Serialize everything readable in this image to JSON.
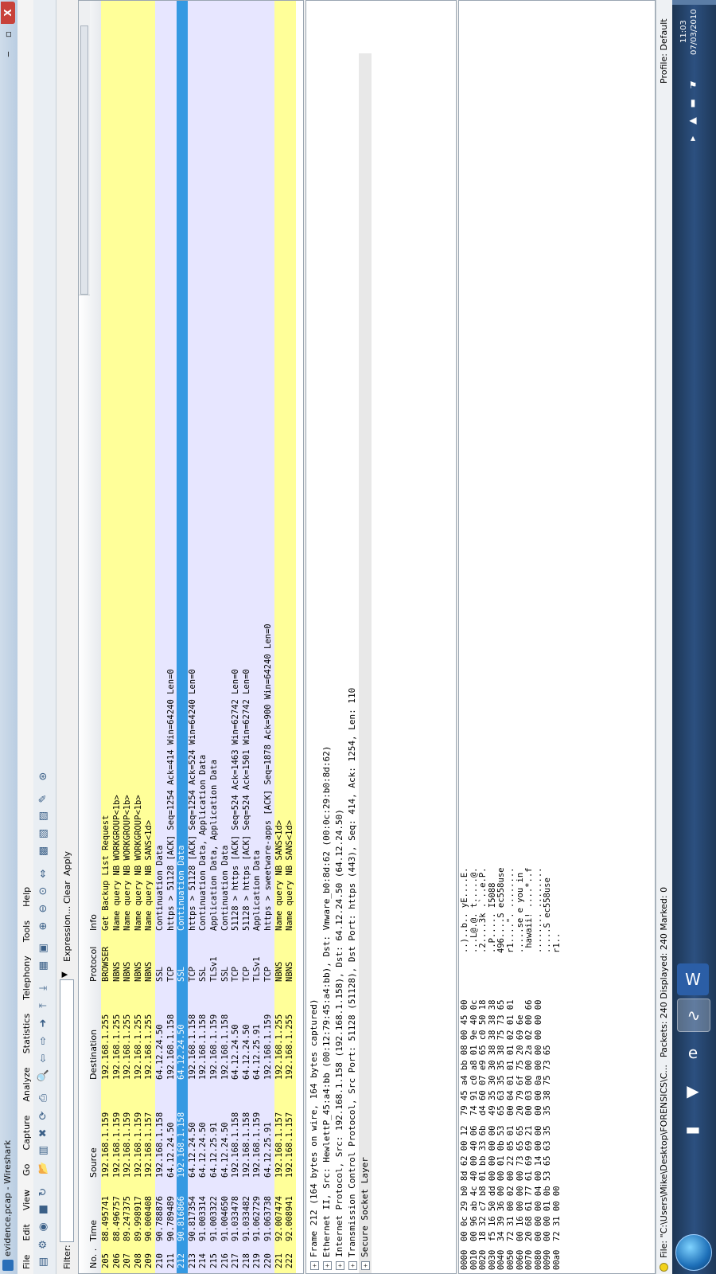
{
  "window": {
    "title": "evidence.pcap - Wireshark",
    "min": "‒",
    "max": "▫",
    "close": "X"
  },
  "menu": [
    "File",
    "Edit",
    "View",
    "Go",
    "Capture",
    "Analyze",
    "Statistics",
    "Telephony",
    "Tools",
    "Help"
  ],
  "filter": {
    "label": "Filter:",
    "value": "",
    "expression": "Expression...",
    "clear": "Clear",
    "apply": "Apply"
  },
  "columns": {
    "no": "No. .",
    "time": "Time",
    "source": "Source",
    "destination": "Destination",
    "protocol": "Protocol",
    "info": "Info"
  },
  "colors": {
    "yellow": "#ffff99",
    "lavender": "#e7e6ff",
    "selected": "#3599e2"
  },
  "packets": [
    {
      "no": "205",
      "time": "88.495741",
      "source": "192.168.1.159",
      "destination": "192.168.1.255",
      "protocol": "BROWSER",
      "info": "Get Backup List Request",
      "color": "yellow"
    },
    {
      "no": "206",
      "time": "88.496757",
      "source": "192.168.1.159",
      "destination": "192.168.1.255",
      "protocol": "NBNS",
      "info": "Name query NB WORKGROUP<1b>",
      "color": "yellow"
    },
    {
      "no": "207",
      "time": "89.247375",
      "source": "192.168.1.159",
      "destination": "192.168.1.255",
      "protocol": "NBNS",
      "info": "Name query NB WORKGROUP<1b>",
      "color": "yellow"
    },
    {
      "no": "208",
      "time": "89.998917",
      "source": "192.168.1.159",
      "destination": "192.168.1.255",
      "protocol": "NBNS",
      "info": "Name query NB WORKGROUP<1b>",
      "color": "yellow"
    },
    {
      "no": "209",
      "time": "90.000408",
      "source": "192.168.1.157",
      "destination": "192.168.1.255",
      "protocol": "NBNS",
      "info": "Name query NB SANS<1d>",
      "color": "yellow"
    },
    {
      "no": "210",
      "time": "90.788876",
      "source": "192.168.1.158",
      "destination": "64.12.24.50",
      "protocol": "SSL",
      "info": "Continuation Data",
      "color": "lavender"
    },
    {
      "no": "211",
      "time": "90.789489",
      "source": "64.12.24.50",
      "destination": "192.168.1.158",
      "protocol": "TCP",
      "info": "https > 51128 [ACK] Seq=1254 Ack=414 Win=64240 Len=0",
      "color": "lavender"
    },
    {
      "no": "212",
      "time": "90.816866",
      "source": "192.168.1.158",
      "destination": "64.12.24.50",
      "protocol": "SSL",
      "info": "Continuation Data",
      "color": "selected"
    },
    {
      "no": "213",
      "time": "90.817354",
      "source": "64.12.24.50",
      "destination": "192.168.1.158",
      "protocol": "TCP",
      "info": "https > 51128 [ACK] Seq=1254 Ack=524 Win=64240 Len=0",
      "color": "lavender"
    },
    {
      "no": "214",
      "time": "91.003314",
      "source": "64.12.24.50",
      "destination": "192.168.1.158",
      "protocol": "SSL",
      "info": "Continuation Data, Application Data",
      "color": "lavender"
    },
    {
      "no": "215",
      "time": "91.003322",
      "source": "64.12.25.91",
      "destination": "192.168.1.159",
      "protocol": "TLSv1",
      "info": "Application Data, Application Data",
      "color": "lavender"
    },
    {
      "no": "216",
      "time": "91.004650",
      "source": "64.12.24.50",
      "destination": "192.168.1.158",
      "protocol": "SSL",
      "info": "Continuation Data",
      "color": "lavender"
    },
    {
      "no": "217",
      "time": "91.033478",
      "source": "192.168.1.158",
      "destination": "64.12.24.50",
      "protocol": "TCP",
      "info": "51128 > https [ACK] Seq=524 Ack=1463 Win=62742 Len=0",
      "color": "lavender"
    },
    {
      "no": "218",
      "time": "91.033482",
      "source": "192.168.1.158",
      "destination": "64.12.24.50",
      "protocol": "TCP",
      "info": "51128 > https [ACK] Seq=524 Ack=1501 Win=62742 Len=0",
      "color": "lavender"
    },
    {
      "no": "219",
      "time": "91.062729",
      "source": "192.168.1.159",
      "destination": "64.12.25.91",
      "protocol": "TLSv1",
      "info": "Application Data",
      "color": "lavender"
    },
    {
      "no": "220",
      "time": "91.063738",
      "source": "64.12.25.91",
      "destination": "192.168.1.159",
      "protocol": "TCP",
      "info": "https > sweetware-apps [ACK] Seq=1878 Ack=900 Win=64240 Len=0",
      "color": "lavender"
    },
    {
      "no": "221",
      "time": "92.007474",
      "source": "192.168.1.157",
      "destination": "192.168.1.255",
      "protocol": "NBNS",
      "info": "Name query NB SANS<1d>",
      "color": "yellow"
    },
    {
      "no": "222",
      "time": "92.008941",
      "source": "192.168.1.157",
      "destination": "192.168.1.255",
      "protocol": "NBNS",
      "info": "Name query NB SANS<1d>",
      "color": "yellow"
    }
  ],
  "details": [
    {
      "text": "Frame 212 (164 bytes on wire, 164 bytes captured)"
    },
    {
      "text": "Ethernet II, Src: HewlettP_45:a4:bb (00:12:79:45:a4:bb), Dst: Vmware_b0:8d:62 (00:0c:29:b0:8d:62)"
    },
    {
      "text": "Internet Protocol, Src: 192.168.1.158 (192.168.1.158), Dst: 64.12.24.50 (64.12.24.50)"
    },
    {
      "text": "Transmission Control Protocol, Src Port: 51128 (51128), Dst Port: https (443), Seq: 414, Ack: 1254, Len: 110"
    },
    {
      "text": "Secure Socket Layer"
    }
  ],
  "bytes": [
    {
      "offset": "0000",
      "hex": "00 0c 29 b0 8d 62 00 12  79 45 a4 bb 08 00 45 00",
      "ascii": "..)..b.. yE....E."
    },
    {
      "offset": "0010",
      "hex": "00 96 ab 4c 40 00 40 06  74 91 c0 a8 01 9e 40 0c",
      "ascii": "...L@.@. t.....@."
    },
    {
      "offset": "0020",
      "hex": "18 32 c7 b8 01 bb 33 6b  d4 60 07 e9 65 c0 50 18",
      "ascii": ".2....3k .`..e.P."
    },
    {
      "offset": "0030",
      "hex": "f5 16 50 dd 00 00 00 00  49 35 30 30 38 38 38 38",
      "ascii": "..P..... I5088"
    },
    {
      "offset": "0040",
      "hex": "34 39 36 00 00 01 0b 53  65 63 35 35 38 75 73 65",
      "ascii": "496....S ec558use"
    },
    {
      "offset": "0050",
      "hex": "72 31 00 02 00 22 05 01  00 04 01 01 01 02 01 01",
      "ascii": "r1....\". ........"
    },
    {
      "offset": "0060",
      "hex": "00 16 00 00 00 73 65 65  20 79 6f 75 20 69 6e",
      "ascii": ".....se e you in"
    },
    {
      "offset": "0070",
      "hex": "20 68 61 77 61 69 69 21  00 03 00 00 2a 02 00 66",
      "ascii": " hawaii! ....*..f"
    },
    {
      "offset": "0080",
      "hex": "00 00 00 04 00 14 00 00  00 00 0a 00 00 00 00 00",
      "ascii": "........ ........"
    },
    {
      "offset": "0090",
      "hex": "00 00 01 0b 53 65 63 35  35 38 75 73 65",
      "ascii": ".....S ec558use"
    },
    {
      "offset": "00a0",
      "hex": "72 31 00 00",
      "ascii": "r1.."
    }
  ],
  "status": {
    "file": "File: \"C:\\Users\\Mike\\Desktop\\FORENSICS\\C...",
    "packets": "Packets: 240 Displayed: 240 Marked: 0",
    "profile": "Profile: Default"
  },
  "taskbar": {
    "time": "11:03",
    "date": "07/03/2010"
  }
}
